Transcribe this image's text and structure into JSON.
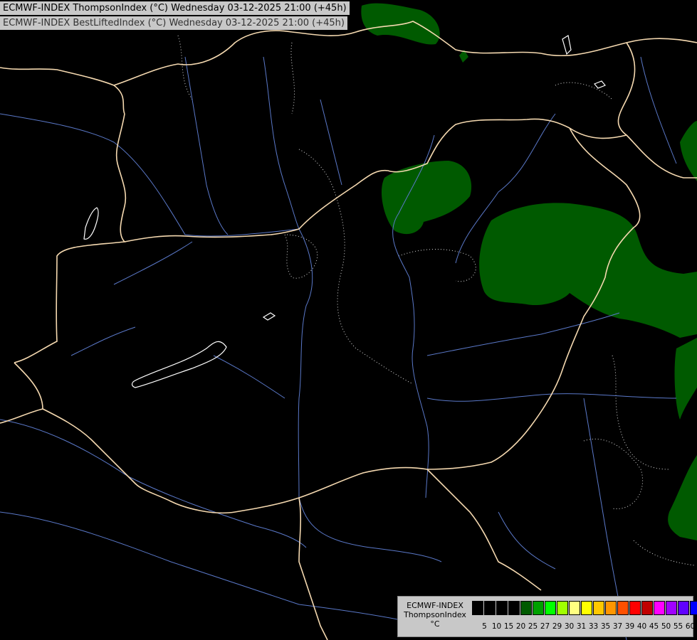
{
  "titles": {
    "line1": "ECMWF-INDEX ThompsonIndex (°C) Wednesday 03-12-2025 21:00 (+45h)",
    "line2": "ECMWF-INDEX BestLiftedIndex (°C) Wednesday 03-12-2025 21:00 (+45h)"
  },
  "legend": {
    "caption_line1": "ECMWF-INDEX",
    "caption_line2": "ThompsonIndex",
    "caption_line3": "°C",
    "ticks": [
      "5",
      "10",
      "15",
      "20",
      "25",
      "27",
      "29",
      "30",
      "31",
      "33",
      "35",
      "37",
      "39",
      "40",
      "45",
      "50",
      "55",
      "60"
    ],
    "colors": [
      "#000000",
      "#000000",
      "#000000",
      "#000000",
      "#005a00",
      "#00a000",
      "#00ff00",
      "#a0ff00",
      "#ffff80",
      "#ffff00",
      "#ffc800",
      "#ff9600",
      "#ff5000",
      "#ff0000",
      "#c00000",
      "#ff00ff",
      "#a000ff",
      "#6000ff",
      "#0000ff"
    ]
  },
  "colors": {
    "background": "#000000",
    "border": "#f5d9b0",
    "river": "#5a78c8",
    "thompson_fill": "#005a00"
  }
}
